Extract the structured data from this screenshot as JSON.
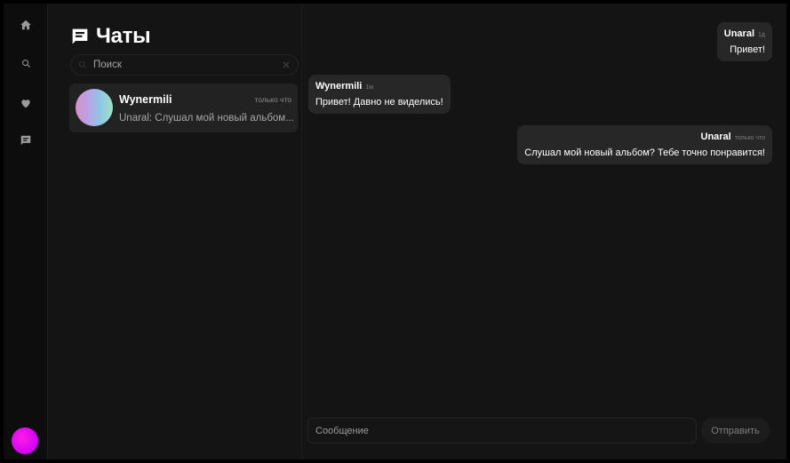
{
  "rail": {
    "items": [
      {
        "icon": "home-icon"
      },
      {
        "icon": "search-icon"
      },
      {
        "icon": "heart-icon"
      },
      {
        "icon": "chat-icon"
      }
    ],
    "avatar_color": "#e01cf0"
  },
  "list": {
    "title": "Чаты",
    "search_placeholder": "Поиск",
    "chats": [
      {
        "name": "Wynermili",
        "time": "только что",
        "preview": "Unaral: Слушал мой новый альбом..."
      }
    ]
  },
  "messages": [
    {
      "author": "Unaral",
      "time": "1д",
      "text": "Привет!",
      "side": "right"
    },
    {
      "author": "Wynermili",
      "time": "1м",
      "text": "Привет! Давно не виделись!",
      "side": "left"
    },
    {
      "author": "Unaral",
      "time": "только что",
      "text": "Слушал мой новый альбом? Тебе точно понравится!",
      "side": "right"
    }
  ],
  "composer": {
    "placeholder": "Сообщение",
    "send_label": "Отправить"
  },
  "colors": {
    "background": "#141414",
    "bubble": "#272727",
    "accent": "#e01cf0"
  }
}
